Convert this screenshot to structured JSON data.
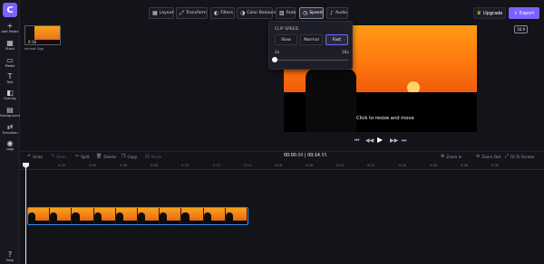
{
  "app": {
    "logo_letter": "C"
  },
  "sidebar": {
    "items": [
      {
        "label": "Add Media",
        "icon": "plus-icon"
      },
      {
        "label": "Stock",
        "icon": "grid-icon"
      },
      {
        "label": "Media",
        "icon": "folder-icon"
      },
      {
        "label": "Text",
        "icon": "text-icon"
      },
      {
        "label": "Overlay",
        "icon": "overlay-icon"
      },
      {
        "label": "Background",
        "icon": "background-icon"
      },
      {
        "label": "Transition",
        "icon": "transition-icon"
      },
      {
        "label": "Logo",
        "icon": "logo-icon"
      }
    ],
    "help_label": "Help"
  },
  "toolbar": {
    "tools": [
      {
        "label": "Layout",
        "icon": "layout-icon"
      },
      {
        "label": "Transform",
        "icon": "transform-icon"
      },
      {
        "label": "Filters",
        "icon": "filters-icon"
      },
      {
        "label": "Color Balance",
        "icon": "color-balance-icon"
      },
      {
        "label": "Fade",
        "icon": "fade-icon"
      },
      {
        "label": "Speed",
        "icon": "speed-icon",
        "active": true
      },
      {
        "label": "Audio",
        "icon": "audio-icon"
      }
    ],
    "upgrade_label": "Upgrade",
    "export_label": "Export"
  },
  "media": {
    "duration": "0:16",
    "filename": "sunset.3gp"
  },
  "preview": {
    "hint": "Click to resize and move",
    "resolution_label": "16:9"
  },
  "speed_popover": {
    "title": "CLIP SPEED",
    "options": [
      "Slow",
      "Normal",
      "Fast"
    ],
    "selected": "Fast",
    "min_label": "2x",
    "max_label": "16x",
    "slider_value": 0.0
  },
  "timeline": {
    "actions": {
      "undo": "Undo",
      "redo": "Redo",
      "split": "Split",
      "delete": "Delete",
      "copy": "Copy",
      "paste": "Paste",
      "zoom_in": "Zoom In",
      "zoom_out": "Zoom Out",
      "fit": "Fit To Screen"
    },
    "current_time": "00:00",
    "current_frame": ".00",
    "total_time": "00:14",
    "total_frame": ".55",
    "ruler": [
      "0:02",
      "0:04",
      "0:06",
      "0:08",
      "0:10",
      "0:12",
      "0:14",
      "0:16",
      "0:18",
      "0:20",
      "0:22",
      "0:24",
      "0:26",
      "0:28",
      "0:30"
    ]
  },
  "colors": {
    "accent": "#7b61ff",
    "clip_border": "#2d8cf0"
  }
}
